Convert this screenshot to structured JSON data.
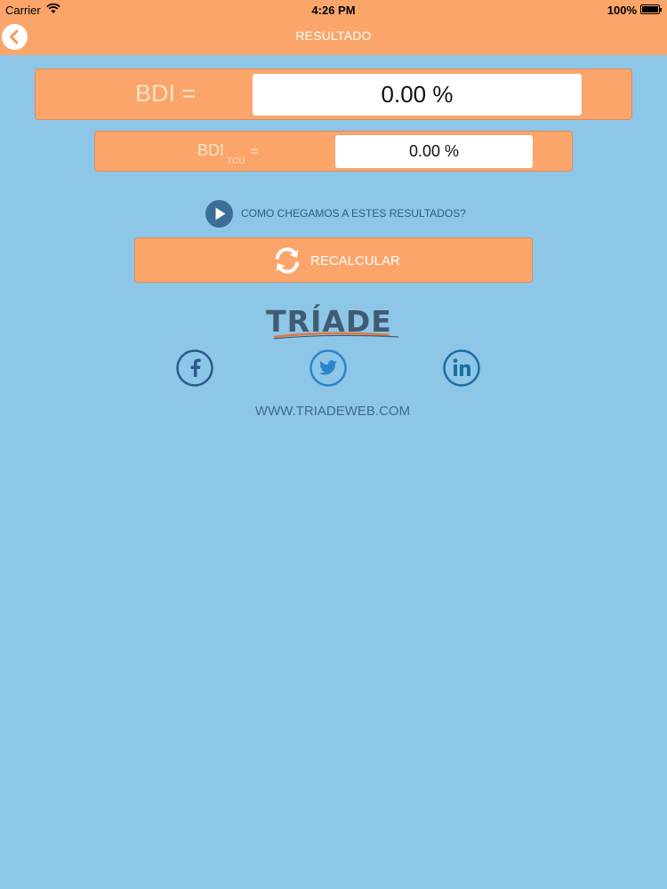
{
  "status_bar": {
    "carrier": "Carrier",
    "time": "4:26 PM",
    "battery": "100%"
  },
  "header": {
    "title": "RESULTADO",
    "back_icon": "chevron-left-icon"
  },
  "results": {
    "bdi_label": "BDI =",
    "bdi_value": "0.00 %",
    "bdi_tcu_label": "BDI",
    "bdi_tcu_subscript": "TCU",
    "bdi_tcu_equals": "=",
    "bdi_tcu_value": "0.00 %"
  },
  "explain": {
    "label": "COMO CHEGAMOS A ESTES RESULTADOS?",
    "icon": "play-icon"
  },
  "recalc": {
    "label": "RECALCULAR",
    "icon": "refresh-icon"
  },
  "brand": {
    "logo_text": "TRÍADE",
    "website": "WWW.TRIADEWEB.COM"
  },
  "social": [
    "facebook-icon",
    "twitter-icon",
    "linkedin-icon"
  ],
  "colors": {
    "background": "#8ec6e8",
    "accent": "#fba56a",
    "text_dark_blue": "#2f5b82"
  }
}
